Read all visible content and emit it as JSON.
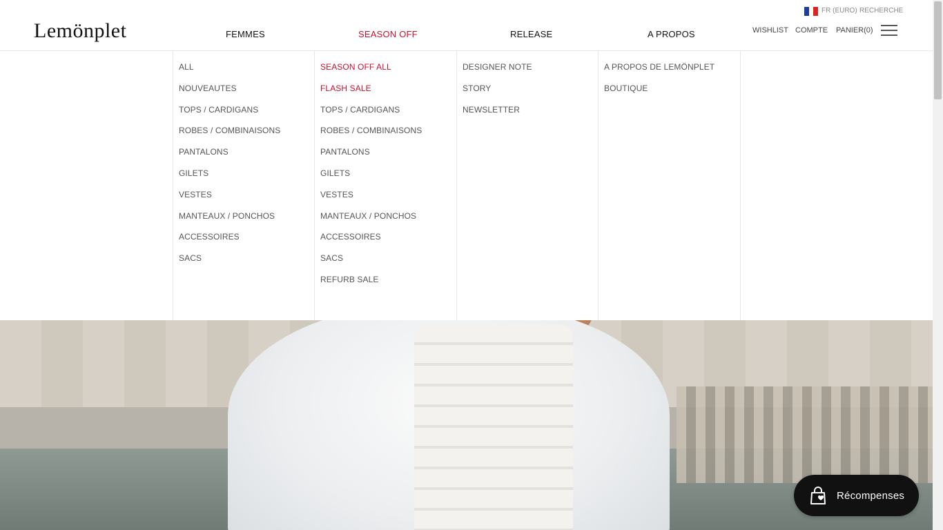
{
  "brand": {
    "logo_text": "Lemönplet"
  },
  "topbar": {
    "region": "FR (EURO)",
    "search": "RECHERCHE"
  },
  "nav": [
    {
      "label": "FEMMES"
    },
    {
      "label": "SEASON OFF"
    },
    {
      "label": "RELEASE"
    },
    {
      "label": "A PROPOS"
    }
  ],
  "utility": {
    "wishlist": "WISHLIST",
    "account": "COMPTE",
    "cart": "PANIER(0)"
  },
  "menu": {
    "femmes": [
      "ALL",
      "NOUVEAUTES",
      "TOPS / CARDIGANS",
      "ROBES / COMBINAISONS",
      "PANTALONS",
      "GILETS",
      "VESTES",
      "MANTEAUX / PONCHOS",
      "ACCESSOIRES",
      "SACS"
    ],
    "season_off": [
      "SEASON OFF ALL",
      "FLASH SALE",
      "TOPS / CARDIGANS",
      "ROBES / COMBINAISONS",
      "PANTALONS",
      "GILETS",
      "VESTES",
      "MANTEAUX / PONCHOS",
      "ACCESSOIRES",
      "SACS",
      "REFURB SALE"
    ],
    "release": [
      "DESIGNER NOTE",
      "STORY",
      "NEWSLETTER"
    ],
    "a_propos": [
      "A PROPOS DE LEMÖNPLET",
      "BOUTIQUE"
    ]
  },
  "rewards": {
    "label": "Récompenses"
  },
  "colors": {
    "accent": "#c8102e",
    "rewards_bg": "#111111"
  }
}
